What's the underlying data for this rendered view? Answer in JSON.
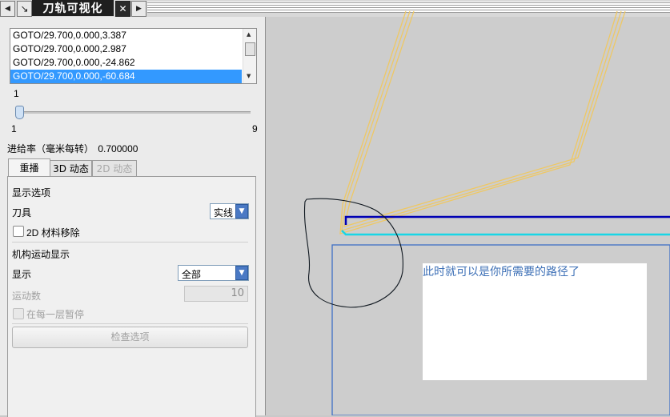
{
  "titlebar": {
    "title": "刀轨可视化",
    "close_glyph": "✕",
    "left_glyph": "◀",
    "right_glyph": "▶",
    "pin_glyph": "↘"
  },
  "goto_list": {
    "rows": [
      "GOTO/29.700,0.000,3.387",
      "GOTO/29.700,0.000,2.987",
      "GOTO/29.700,0.000,-24.862",
      "GOTO/29.700,0.000,-60.684"
    ],
    "selected_index": 3
  },
  "slider": {
    "current": "1",
    "min": "1",
    "max": "9",
    "position_fraction": 0.0
  },
  "feed_rate": {
    "label": "进给率（毫米每转）",
    "value": "0.700000"
  },
  "tabs": [
    {
      "label": "重播",
      "state": "active"
    },
    {
      "label": "3D 动态",
      "state": "normal"
    },
    {
      "label": "2D 动态",
      "state": "disabled"
    }
  ],
  "display_options": {
    "section_title": "显示选项",
    "tool_label": "刀具",
    "tool_value": "实线",
    "material_removal_label": "2D 材料移除"
  },
  "mechanism": {
    "section_title": "机构运动显示",
    "display_label": "显示",
    "display_value": "全部",
    "motion_count_label": "运动数",
    "motion_count_value": "10",
    "pause_label": "在每一层暂停",
    "check_button": "检查选项"
  },
  "viewport": {
    "annotation": "此时就可以是你所需要的路径了",
    "colors": {
      "toolpath": "#f0c860",
      "cut_line": "#0000b4",
      "feed_line": "#19d6e6",
      "boundary": "#3f6fc6",
      "sketch": "#101820"
    }
  }
}
